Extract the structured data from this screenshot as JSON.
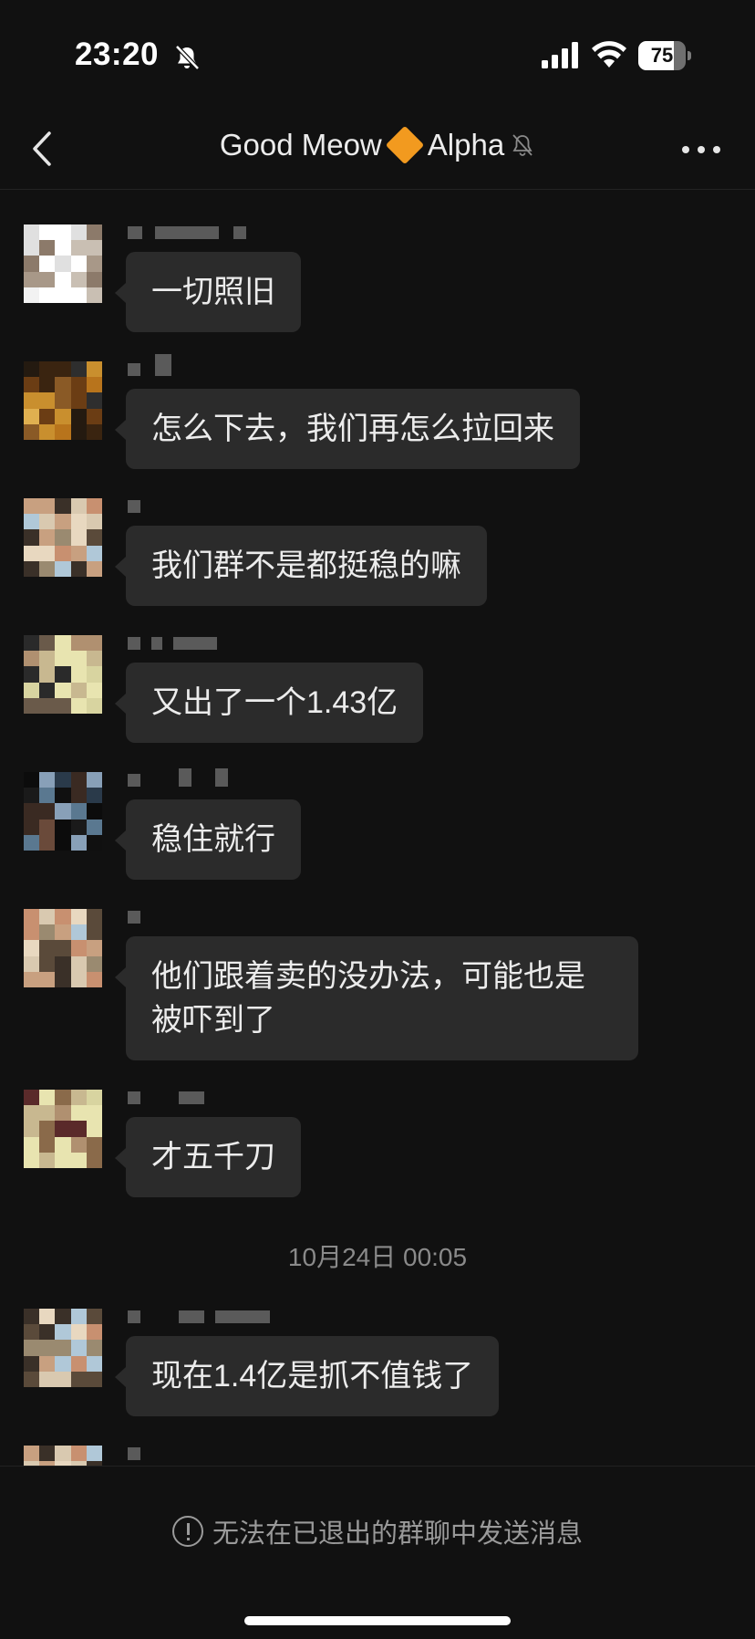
{
  "status_bar": {
    "time": "23:20",
    "battery_level": "75",
    "battery_fraction": 0.75,
    "icons": [
      "bell-slash-icon",
      "cellular-signal-icon",
      "wifi-icon",
      "battery-icon"
    ]
  },
  "header": {
    "title_left": "Good Meow",
    "title_right": "Alpha",
    "icons": [
      "back-chevron-icon",
      "orange-diamond-icon",
      "bell-slash-icon",
      "more-dots-icon"
    ]
  },
  "messages": [
    {
      "text": "一切照旧"
    },
    {
      "text": "怎么下去，我们再怎么拉回来"
    },
    {
      "text": "我们群不是都挺稳的嘛"
    },
    {
      "text": "又出了一个1.43亿"
    },
    {
      "text": "稳住就行"
    },
    {
      "text": "他们跟着卖的没办法，可能也是被吓到了"
    },
    {
      "text": "才五千刀"
    },
    {
      "text": "现在1.4亿是抓不值钱了"
    }
  ],
  "timestamp": "10月24日 00:05",
  "footer": {
    "notice": "无法在已退出的群聊中发送消息",
    "icon": "exclamation-circle-icon"
  },
  "colors": {
    "background": "#111111",
    "bubble": "#2b2b2b",
    "accent_diamond": "#f29a1f"
  }
}
